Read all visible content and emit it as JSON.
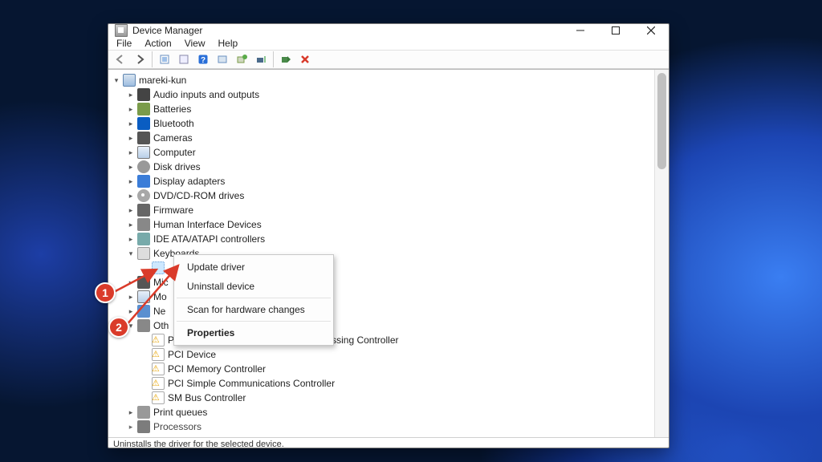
{
  "window": {
    "title": "Device Manager",
    "menubar": [
      "File",
      "Action",
      "View",
      "Help"
    ]
  },
  "toolbar": {
    "back": "back-icon",
    "forward": "forward-icon",
    "scan": "scan-icon"
  },
  "tree": {
    "root": "mareki-kun",
    "items": [
      {
        "label": "Audio inputs and outputs",
        "icon": "ic-sp"
      },
      {
        "label": "Batteries",
        "icon": "ic-ba"
      },
      {
        "label": "Bluetooth",
        "icon": "ic-bt"
      },
      {
        "label": "Cameras",
        "icon": "ic-cam"
      },
      {
        "label": "Computer",
        "icon": "ic-mon"
      },
      {
        "label": "Disk drives",
        "icon": "ic-dd"
      },
      {
        "label": "Display adapters",
        "icon": "ic-disp"
      },
      {
        "label": "DVD/CD-ROM drives",
        "icon": "ic-dvd"
      },
      {
        "label": "Firmware",
        "icon": "ic-fw"
      },
      {
        "label": "Human Interface Devices",
        "icon": "ic-hid"
      },
      {
        "label": "IDE ATA/ATAPI controllers",
        "icon": "ic-ide"
      }
    ],
    "keyboards_label": "Keyboards",
    "partial": [
      {
        "label": "Mic",
        "icon": "ic-mic"
      },
      {
        "label": "Mo",
        "icon": "ic-mon"
      },
      {
        "label": "Ne",
        "icon": "ic-net"
      }
    ],
    "other_label": "Oth",
    "other_items": [
      "PCI Data Acquisition and Signal Processing Controller",
      "PCI Device",
      "PCI Memory Controller",
      "PCI Simple Communications Controller",
      "SM Bus Controller"
    ],
    "tail": [
      {
        "label": "Print queues",
        "icon": "ic-pq"
      },
      {
        "label": "Processors",
        "icon": "ic-cpu"
      }
    ]
  },
  "context_menu": {
    "update": "Update driver",
    "uninstall": "Uninstall device",
    "scan": "Scan for hardware changes",
    "properties": "Properties"
  },
  "statusbar": "Uninstalls the driver for the selected device.",
  "annotations": {
    "badge1": "1",
    "badge2": "2"
  }
}
